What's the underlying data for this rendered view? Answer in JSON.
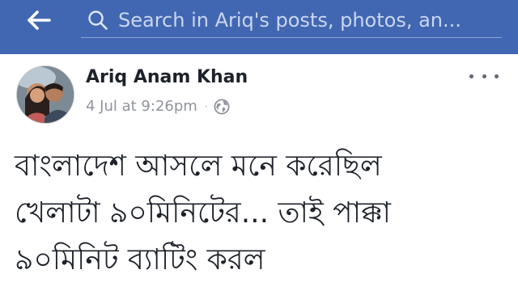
{
  "header": {
    "search_placeholder": "Search in Ariq's posts, photos, an...",
    "back_icon": "arrow-left-icon",
    "search_icon": "search-icon"
  },
  "post": {
    "author": "Ariq Anam Khan",
    "timestamp": "4 Jul at 9:26pm",
    "separator": "·",
    "privacy_icon": "globe-icon",
    "more_icon": "more-horizontal-icon",
    "text_lines": [
      "বাংলাদেশ আসলে মনে করেছিল",
      "খেলাটা ৯০মিনিটের... তাই পাক্কা",
      "৯০মিনিট ব্যাটিং করল"
    ]
  },
  "colors": {
    "header_bg": "#4267b2",
    "text": "#1d2129",
    "meta": "#90949c"
  }
}
